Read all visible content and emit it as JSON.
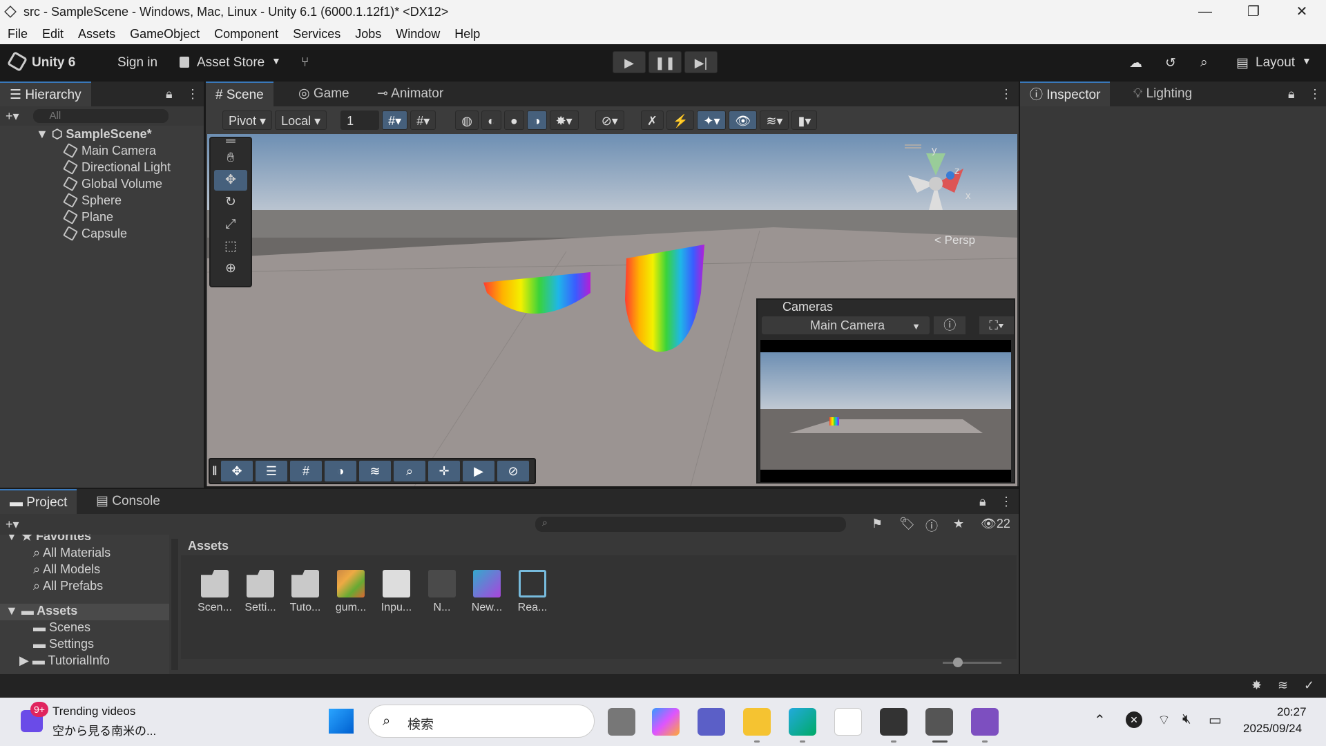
{
  "window": {
    "title": "src - SampleScene - Windows, Mac, Linux - Unity 6.1 (6000.1.12f1)* <DX12>",
    "minimize": "—",
    "restore": "❐",
    "close": "✕"
  },
  "menu": [
    "File",
    "Edit",
    "Assets",
    "GameObject",
    "Component",
    "Services",
    "Jobs",
    "Window",
    "Help"
  ],
  "toolbar": {
    "brand": "Unity 6",
    "sign_in": "Sign in",
    "asset_store": "Asset Store",
    "layout": "Layout"
  },
  "hierarchy": {
    "tab": "Hierarchy",
    "search_placeholder": "All",
    "scene": "SampleScene*",
    "items": [
      "Main Camera",
      "Directional Light",
      "Global Volume",
      "Sphere",
      "Plane",
      "Capsule"
    ]
  },
  "scene_tabs": [
    "Scene",
    "Game",
    "Animator"
  ],
  "scene_toolbar": {
    "pivot": "Pivot",
    "local": "Local",
    "grid_value": "1"
  },
  "gizmo": {
    "y": "y",
    "z": "z",
    "x": "x",
    "persp": "< Persp"
  },
  "cameras": {
    "title": "Cameras",
    "selected": "Main Camera"
  },
  "inspector_tabs": [
    "Inspector",
    "Lighting"
  ],
  "project": {
    "tabs": [
      "Project",
      "Console"
    ],
    "count": "22",
    "favorites_label": "Favorites",
    "favorites": [
      "All Materials",
      "All Models",
      "All Prefabs"
    ],
    "assets_label": "Assets",
    "asset_folders": [
      "Scenes",
      "Settings",
      "TutorialInfo"
    ],
    "breadcrumb": "Assets",
    "assets": [
      "Scen...",
      "Setti...",
      "Tuto...",
      "gum...",
      "Inpu...",
      "N...",
      "New...",
      "Rea..."
    ]
  },
  "taskbar": {
    "badge": "9+",
    "news_title": "Trending videos",
    "news_sub": "空から見る南米の...",
    "search": "検索",
    "time": "20:27",
    "date": "2025/09/24"
  },
  "colors": {
    "accent": "#3a79bb",
    "active_tool": "#46607c"
  }
}
